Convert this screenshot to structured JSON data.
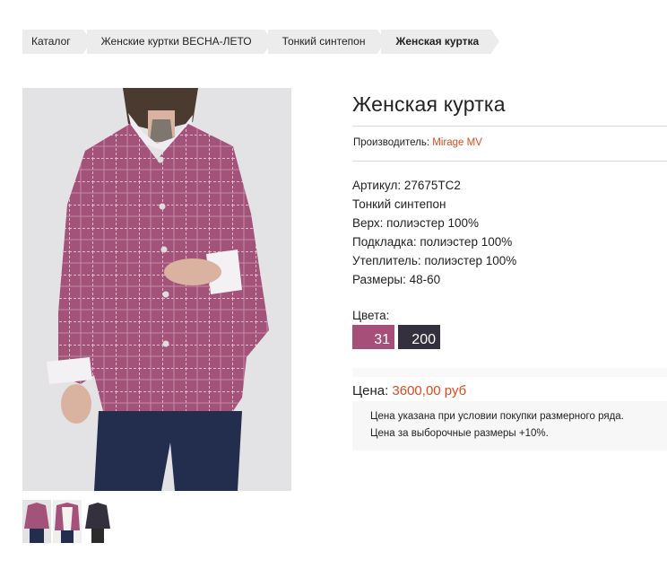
{
  "breadcrumb": {
    "items": [
      "Каталог",
      "Женские куртки ВЕСНА-ЛЕТО",
      "Тонкий синтепон"
    ],
    "current": "Женская куртка"
  },
  "product": {
    "title": "Женская куртка",
    "maker_label": "Производитель: ",
    "maker_name": "Mirage MV",
    "properties": [
      "Артикул: 27675ТС2",
      "Тонкий синтепон",
      "Верх: полиэстер 100%",
      "Подкладка: полиэстер 100%",
      "Утеплитель: полиэстер 100%",
      "Размеры: 48-60"
    ],
    "colors_label": "Цвета:",
    "colors": [
      {
        "code": "31",
        "color": "#a64f78"
      },
      {
        "code": "200",
        "color": "#34303d"
      }
    ],
    "price_label": "Цена: ",
    "price_value": "3600,00 руб",
    "price_notes": [
      "Цена указана при условии покупки размерного ряда.",
      "Цена за выборочные размеры +10%."
    ]
  },
  "images": {
    "main": "jacket-photo",
    "thumbnails": [
      "thumb-front",
      "thumb-lining",
      "thumb-dark"
    ]
  },
  "colors": {
    "accent": "#e0491e",
    "jacket": "#a64f78",
    "breadcrumb_bg": "#ececec"
  }
}
